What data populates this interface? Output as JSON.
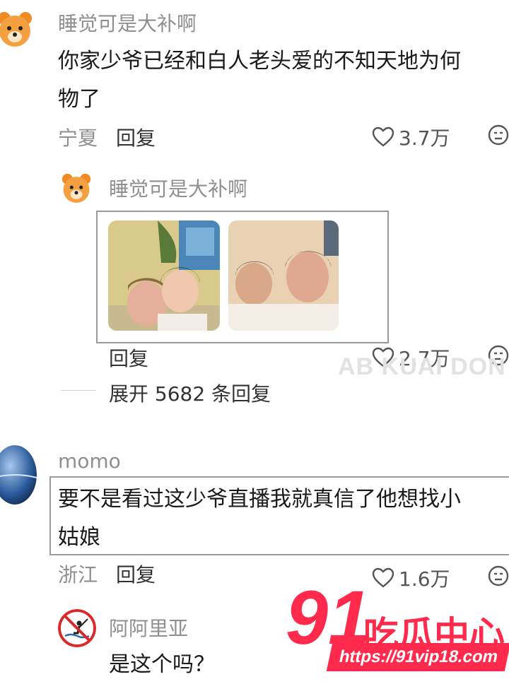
{
  "comments": [
    {
      "username": "睡觉可是大补啊",
      "avatar_icon": "bear-icon",
      "text_line1": "你家少爷已经和白人老头爱的不知天地为何",
      "text_line2": "物了",
      "location": "宁夏",
      "reply_label": "回复",
      "likes": "3.7万"
    },
    {
      "username": "momo",
      "avatar_icon": "planet-icon",
      "text_line1": "要不是看过这少爷直播我就真信了他想找小",
      "text_line2": "姑娘",
      "location": "浙江",
      "reply_label": "回复",
      "likes": "1.6万"
    }
  ],
  "replies": [
    {
      "username": "睡觉可是大补啊",
      "avatar_icon": "bear-icon",
      "reply_label": "回复",
      "likes": "2.7万",
      "expand_label": "展开 5682 条回复"
    },
    {
      "username": "阿阿里亚",
      "avatar_icon": "no-fishing-icon",
      "text": "是这个吗？"
    }
  ],
  "watermark": "AB KUAI DON",
  "logo": {
    "number": "91",
    "name": "吃瓜中心",
    "url": "https://91vip18.com"
  },
  "colors": {
    "accent": "#ff2a4c",
    "muted_text": "#8f8f8f"
  }
}
